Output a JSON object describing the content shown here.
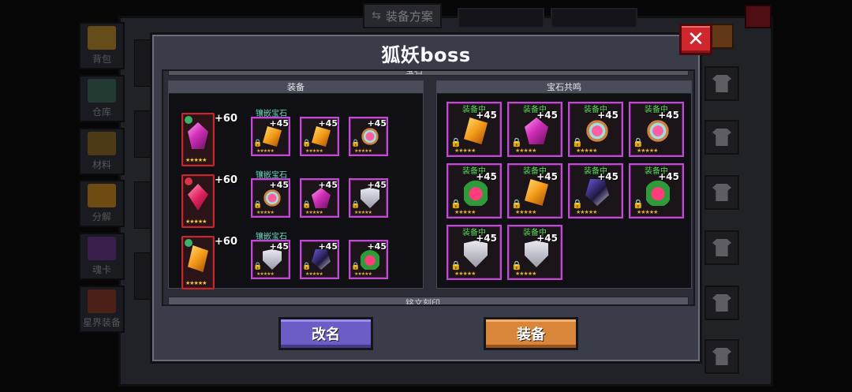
{
  "background": {
    "top_tab_label": "装备方案",
    "side_tabs": [
      {
        "label": "背包",
        "color": "#b88a2e"
      },
      {
        "label": "仓库",
        "color": "#3e6a5a"
      },
      {
        "label": "材料",
        "color": "#8a6a2a"
      },
      {
        "label": "分解",
        "color": "#c88a20"
      },
      {
        "label": "魂卡",
        "color": "#6a3a8a"
      },
      {
        "label": "星界装备",
        "color": "#8a3a2a"
      }
    ],
    "right_slot_icon": "shirt-icon"
  },
  "dialog": {
    "title": "狐妖boss",
    "close_symbol": "✕",
    "peek_top_label": "宝石",
    "peek_bottom_label": "铭文刻印",
    "equip_section": {
      "header": "装备",
      "rows": [
        {
          "item_level": "+60",
          "item_gem": "gem-purple",
          "badge_color": "#3ab26b",
          "inlay_label": "镶嵌宝石",
          "stars": "★★★★★",
          "gems": [
            {
              "level": "+45",
              "type": "gem-orange"
            },
            {
              "level": "+45",
              "type": "gem-orange"
            },
            {
              "level": "+45",
              "type": "gem-ring"
            }
          ]
        },
        {
          "item_level": "+60",
          "item_gem": "gem-red",
          "badge_color": "#d8344a",
          "inlay_label": "镶嵌宝石",
          "stars": "★★★★★",
          "gems": [
            {
              "level": "+45",
              "type": "gem-ring"
            },
            {
              "level": "+45",
              "type": "gem-purple"
            },
            {
              "level": "+45",
              "type": "gem-shield"
            }
          ]
        },
        {
          "item_level": "+60",
          "item_gem": "gem-orange",
          "badge_color": "#3ab26b",
          "inlay_label": "镶嵌宝石",
          "stars": "★★★★★",
          "gems": [
            {
              "level": "+45",
              "type": "gem-shield"
            },
            {
              "level": "+45",
              "type": "gem-dark"
            },
            {
              "level": "+45",
              "type": "gem-green"
            }
          ]
        }
      ]
    },
    "resonance_section": {
      "header": "宝石共鸣",
      "slots": [
        {
          "tag": "装备中",
          "level": "+45",
          "type": "gem-orange"
        },
        {
          "tag": "装备中",
          "level": "+45",
          "type": "gem-purple"
        },
        {
          "tag": "装备中",
          "level": "+45",
          "type": "gem-ring"
        },
        {
          "tag": "装备中",
          "level": "+45",
          "type": "gem-ring"
        },
        {
          "tag": "装备中",
          "level": "+45",
          "type": "gem-green"
        },
        {
          "tag": "装备中",
          "level": "+45",
          "type": "gem-orange"
        },
        {
          "tag": "装备中",
          "level": "+45",
          "type": "gem-dark"
        },
        {
          "tag": "装备中",
          "level": "+45",
          "type": "gem-green"
        },
        {
          "tag": "装备中",
          "level": "+45",
          "type": "gem-shield"
        },
        {
          "tag": "装备中",
          "level": "+45",
          "type": "gem-shield"
        }
      ]
    },
    "buttons": {
      "rename": "改名",
      "equip": "装备"
    }
  }
}
